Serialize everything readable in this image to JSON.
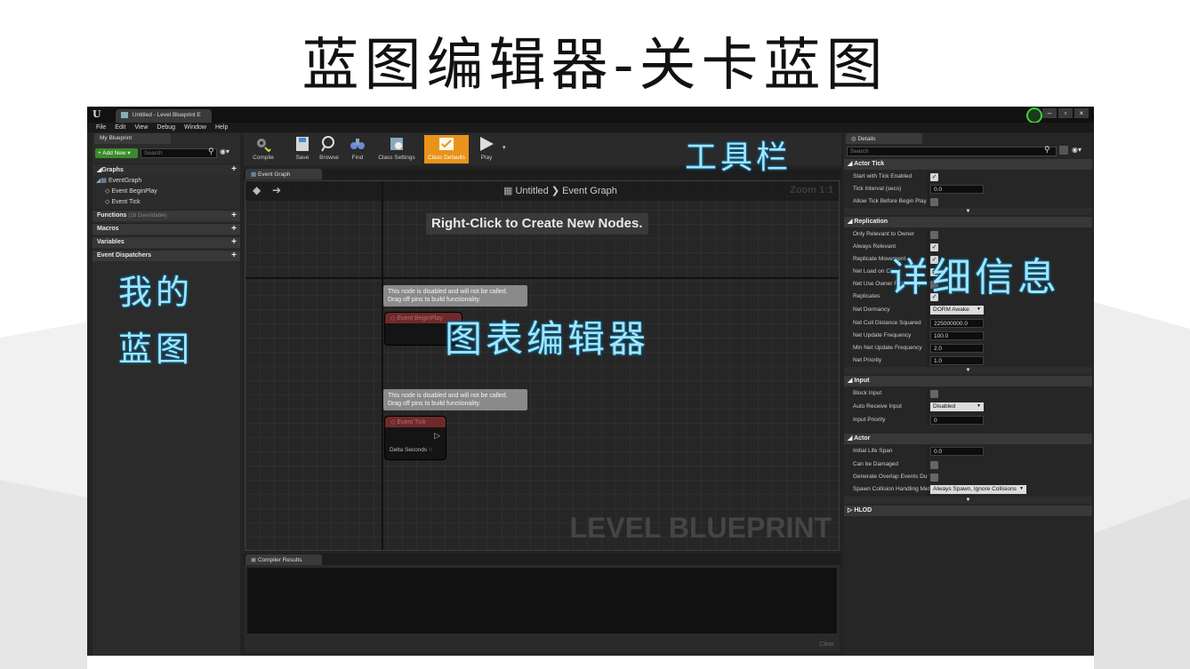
{
  "slide_title": "蓝图编辑器-关卡蓝图",
  "annotations": {
    "toolbar": "工具栏",
    "details": "详细信息",
    "my_blueprint_1": "我的",
    "my_blueprint_2": "蓝图",
    "graph_editor": "图表编辑器"
  },
  "window": {
    "tab_title": "Untitled - Level Blueprint E",
    "tab_close": "×",
    "buttons": [
      "–",
      "▫",
      "×"
    ]
  },
  "menu": [
    "File",
    "Edit",
    "View",
    "Debug",
    "Window",
    "Help"
  ],
  "my_blueprint": {
    "tab_label": "My Blueprint",
    "add_new": "+ Add New ▾",
    "search_placeholder": "Search",
    "graphs_label": "Graphs",
    "graph_items": [
      "EventGraph",
      "Event BeginPlay",
      "Event Tick"
    ],
    "categories": [
      {
        "label": "Functions",
        "sub": "(18 Overridable)"
      },
      {
        "label": "Macros",
        "sub": ""
      },
      {
        "label": "Variables",
        "sub": ""
      },
      {
        "label": "Event Dispatchers",
        "sub": ""
      }
    ]
  },
  "toolbar": {
    "compile": "Compile",
    "save": "Save",
    "browse": "Browse",
    "find": "Find",
    "class_settings": "Class Settings",
    "class_defaults": "Class Defaults",
    "play": "Play"
  },
  "graph": {
    "tab_label": "Event Graph",
    "breadcrumb_root": "Untitled",
    "breadcrumb_sep": "❯",
    "breadcrumb_leaf": "Event Graph",
    "zoom": "Zoom 1:1",
    "hint": "Right-Click to Create New Nodes.",
    "comment_line1": "This node is disabled and will not be called.",
    "comment_line2": "Drag off pins to build functionality.",
    "node_begin_play": "Event BeginPlay",
    "node_tick": "Event Tick",
    "delta_seconds": "Delta Seconds",
    "watermark": "LEVEL BLUEPRINT"
  },
  "compiler": {
    "tab_label": "Compiler Results",
    "clear": "Clear"
  },
  "details": {
    "tab_label": "Details",
    "search_placeholder": "Search",
    "sections": {
      "actor_tick": "Actor Tick",
      "replication": "Replication",
      "input": "Input",
      "actor": "Actor",
      "hlod": "HLOD"
    },
    "actor_tick": {
      "start_with_tick": "Start with Tick Enabled",
      "tick_interval": "Tick Interval (secs)",
      "tick_interval_value": "0.0",
      "allow_tick": "Allow Tick Before Begin Play"
    },
    "replication": {
      "only_relevant_owner": "Only Relevant to Owner",
      "always_relevant": "Always Relevant",
      "replicate_movement": "Replicate Movement",
      "net_load_client": "Net Load on Client",
      "net_use_owner": "Net Use Owner Relevancy",
      "replicates": "Replicates",
      "net_dormancy": "Net Dormancy",
      "net_dormancy_value": "DORM Awake",
      "net_cull": "Net Cull Distance Squared",
      "net_cull_value": "225000000.0",
      "net_update": "Net Update Frequency",
      "net_update_value": "100.0",
      "min_net_update": "Min Net Update Frequency",
      "min_net_update_value": "2.0",
      "net_priority": "Net Priority",
      "net_priority_value": "1.0"
    },
    "input": {
      "block_input": "Block Input",
      "auto_receive": "Auto Receive Input",
      "auto_receive_value": "Disabled",
      "input_priority": "Input Priority",
      "input_priority_value": "0"
    },
    "actor": {
      "initial_life_span": "Initial Life Span",
      "initial_life_span_value": "0.0",
      "can_be_damaged": "Can be Damaged",
      "gen_overlap": "Generate Overlap Events During Level Streaming",
      "spawn_collision": "Spawn Collision Handling Method",
      "spawn_collision_value": "Always Spawn, Ignore Collisions"
    }
  },
  "colors": {
    "accent_orange": "#e8941a",
    "annotation_cyan": "#9fe6ff",
    "node_red": "#6e2a2a",
    "add_new_green": "#3a8a2a"
  }
}
